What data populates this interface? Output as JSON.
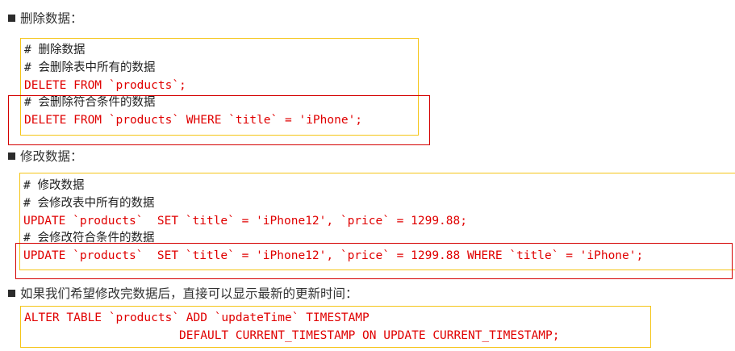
{
  "sections": [
    {
      "heading": "删除数据：",
      "lines": [
        {
          "text": "# 删除数据",
          "kind": "comment"
        },
        {
          "text": "# 会删除表中所有的数据",
          "kind": "comment"
        },
        {
          "text": "DELETE FROM `products`;",
          "kind": "sql"
        },
        {
          "text": "# 会删除符合条件的数据",
          "kind": "comment"
        },
        {
          "text": "DELETE FROM `products` WHERE `title` = 'iPhone';",
          "kind": "sql"
        }
      ]
    },
    {
      "heading": "修改数据：",
      "lines": [
        {
          "text": "# 修改数据",
          "kind": "comment"
        },
        {
          "text": "# 会修改表中所有的数据",
          "kind": "comment"
        },
        {
          "text": "UPDATE `products`  SET `title` = 'iPhone12', `price` = 1299.88;",
          "kind": "sql"
        },
        {
          "text": "# 会修改符合条件的数据",
          "kind": "comment"
        },
        {
          "text": "UPDATE `products`  SET `title` = 'iPhone12', `price` = 1299.88 WHERE `title` = 'iPhone';",
          "kind": "sql"
        }
      ]
    },
    {
      "heading": "如果我们希望修改完数据后，直接可以显示最新的更新时间：",
      "lines": [
        {
          "text": "ALTER TABLE `products` ADD `updateTime` TIMESTAMP",
          "kind": "sql"
        },
        {
          "text": "                      DEFAULT CURRENT_TIMESTAMP ON UPDATE CURRENT_TIMESTAMP;",
          "kind": "sql"
        }
      ]
    }
  ],
  "colors": {
    "sql_text": "#e00000",
    "comment_text": "#1f1f1f",
    "box_border": "#f5c518",
    "highlight_border": "#d40000"
  }
}
